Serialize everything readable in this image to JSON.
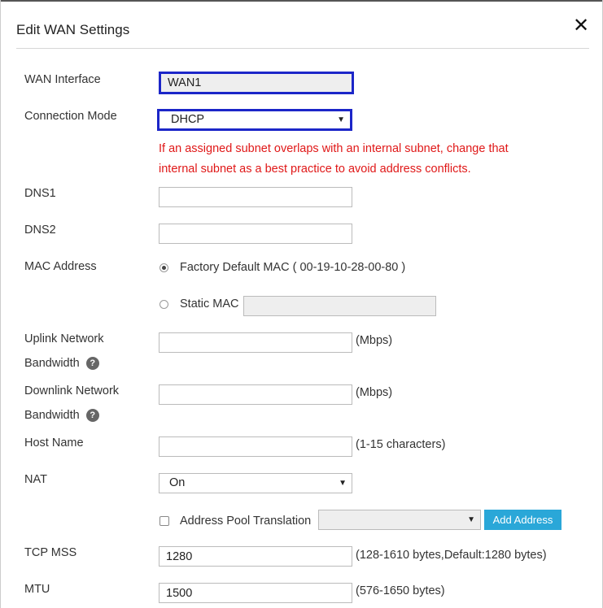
{
  "dialog": {
    "title": "Edit WAN Settings",
    "close_glyph": "✕"
  },
  "wan_interface": {
    "label": "WAN Interface",
    "value": "WAN1"
  },
  "connection_mode": {
    "label": "Connection Mode",
    "value": "DHCP"
  },
  "warning": {
    "line1": "If an assigned subnet overlaps with an internal subnet, change that",
    "line2": "internal subnet as a best practice to avoid address conflicts."
  },
  "dns1": {
    "label": "DNS1",
    "value": ""
  },
  "dns2": {
    "label": "DNS2",
    "value": ""
  },
  "mac": {
    "label": "MAC Address",
    "factory_label": "Factory Default MAC ( 00-19-10-28-00-80 )",
    "static_label": "Static MAC",
    "static_value": "",
    "selected": "factory"
  },
  "uplink": {
    "label_line1": "Uplink Network",
    "label_line2": "Bandwidth",
    "help": "?",
    "value": "",
    "unit": "(Mbps)"
  },
  "downlink": {
    "label_line1": "Downlink Network",
    "label_line2": "Bandwidth",
    "help": "?",
    "value": "",
    "unit": "(Mbps)"
  },
  "host_name": {
    "label": "Host Name",
    "value": "",
    "hint": "(1-15 characters)"
  },
  "nat": {
    "label": "NAT",
    "value": "On"
  },
  "address_pool": {
    "label": "Address Pool Translation",
    "checked": false,
    "value": "",
    "button": "Add Address"
  },
  "tcp_mss": {
    "label": "TCP MSS",
    "value": "1280",
    "hint": "(128-1610 bytes,Default:1280 bytes)"
  },
  "mtu": {
    "label": "MTU",
    "value": "1500",
    "hint": "(576-1650 bytes)"
  },
  "icons": {
    "close": "close-icon",
    "dropdown": "chevron-down-icon",
    "help": "help-icon"
  }
}
